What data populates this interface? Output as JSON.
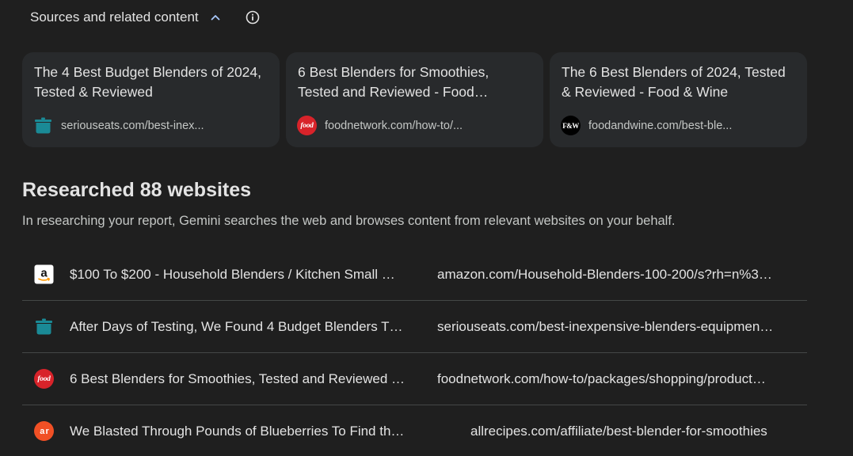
{
  "sources": {
    "title": "Sources and related content",
    "cards": [
      {
        "title": "The 4 Best Budget Blenders of 2024, Tested & Reviewed",
        "domain": "seriouseats.com/best-inex...",
        "icon": "pot-icon"
      },
      {
        "title": "6 Best Blenders for Smoothies, Tested and Reviewed - Food…",
        "domain": "foodnetwork.com/how-to/...",
        "icon": "food-network-icon",
        "icon_text": "food"
      },
      {
        "title": "The 6 Best Blenders of 2024, Tested & Reviewed - Food & Wine",
        "domain": "foodandwine.com/best-ble...",
        "icon": "food-and-wine-icon",
        "icon_text": "F&W"
      }
    ]
  },
  "researched": {
    "title": "Researched 88 websites",
    "description": "In researching your report, Gemini searches the web and browses content from relevant websites on your behalf.",
    "rows": [
      {
        "title": "$100 To $200 - Household Blenders / Kitchen Small …",
        "url": "amazon.com/Household-Blenders-100-200/s?rh=n%3…",
        "icon": "amazon-icon",
        "icon_text": "a"
      },
      {
        "title": "After Days of Testing, We Found 4 Budget Blenders T…",
        "url": "seriouseats.com/best-inexpensive-blenders-equipmen…",
        "icon": "pot-icon"
      },
      {
        "title": "6 Best Blenders for Smoothies, Tested and Reviewed …",
        "url": "foodnetwork.com/how-to/packages/shopping/product…",
        "icon": "food-network-icon",
        "icon_text": "food"
      },
      {
        "title": "We Blasted Through Pounds of Blueberries To Find th…",
        "url": "allrecipes.com/affiliate/best-blender-for-smoothies",
        "icon": "allrecipes-icon",
        "icon_text": "a r"
      }
    ]
  },
  "colors": {
    "background": "#1f1f1f",
    "card": "#282a2c",
    "divider": "#444746",
    "serious_eats_teal": "#1a8a96",
    "food_network_red": "#d8232a",
    "allrecipes_orange": "#f15025"
  }
}
